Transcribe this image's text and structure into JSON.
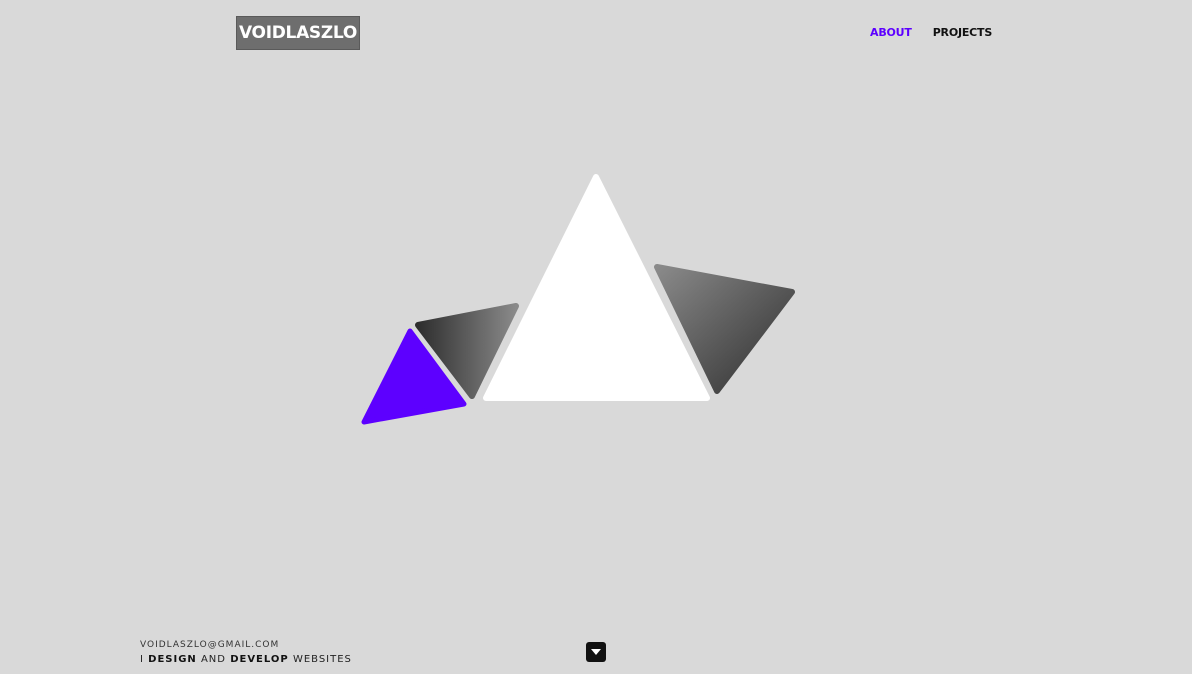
{
  "header": {
    "logo_text": "VOIDLASZLO",
    "nav": [
      {
        "label": "ABOUT",
        "active": true
      },
      {
        "label": "PROJECTS",
        "active": false
      }
    ]
  },
  "colors": {
    "background": "#d9d9d9",
    "accent": "#5d00ff",
    "logo_bg": "#6e6e6e"
  },
  "hero": {
    "graphic": "triangle-cluster"
  },
  "footer": {
    "email": "VOIDLASZLO@GMAIL.COM",
    "tagline": {
      "prefix": "I",
      "word1": "DESIGN",
      "connector": "AND",
      "word2": "DEVELOP",
      "suffix": "WEBSITES"
    },
    "scroll_icon": "caret-down-icon"
  }
}
